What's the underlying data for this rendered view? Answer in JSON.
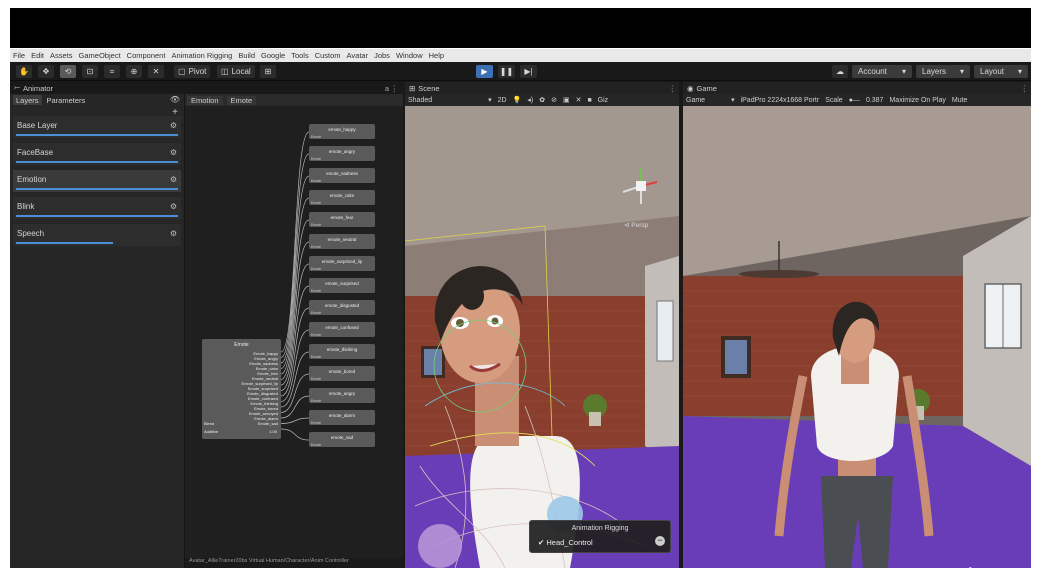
{
  "menu": [
    "File",
    "Edit",
    "Assets",
    "GameObject",
    "Component",
    "Animation Rigging",
    "Build",
    "Google",
    "Tools",
    "Custom",
    "Avatar",
    "Jobs",
    "Window",
    "Help"
  ],
  "toolbar": {
    "tools": [
      "hand-tool",
      "move-tool",
      "rotate-tool",
      "scale-tool",
      "rect-tool",
      "transform-tool",
      "custom-tool"
    ],
    "pivot_label": "Pivot",
    "local_label": "Local",
    "account_label": "Account",
    "layers_label": "Layers",
    "layout_label": "Layout"
  },
  "animator": {
    "title": "Animator",
    "tabs": [
      "Layers",
      "Parameters"
    ],
    "layers": [
      {
        "name": "Base Layer",
        "weight": 1.0
      },
      {
        "name": "FaceBase",
        "weight": 1.0
      },
      {
        "name": "Emotion",
        "weight": 1.0
      },
      {
        "name": "Blink",
        "weight": 1.0
      },
      {
        "name": "Speech",
        "weight": 0.6
      }
    ],
    "breadcrumb": [
      "Emotion",
      "Emote"
    ],
    "blend_tree_title": "Emote",
    "blend_params": [
      "Emote_happy",
      "Emote_angry",
      "Emote_sadness",
      "Emote_calm",
      "Emote_fear",
      "Emote_neutral",
      "Emote_surprised_lip",
      "Emote_surprised",
      "Emote_disgusted",
      "Emote_confused",
      "Emote_thinking",
      "Emote_bored",
      "Emote_annoyed",
      "Emote_alarm",
      "Emote_sad"
    ],
    "blend_footer_1": "Blend",
    "blend_footer_2": "Additive",
    "blend_value": "1.00",
    "states": [
      "emote_happy",
      "emote_angry",
      "emote_sadness",
      "emote_calm",
      "emote_fear",
      "emote_neutral",
      "emote_surprised_lip",
      "emote_surprised",
      "emote_disgusted",
      "emote_confused",
      "emote_thinking",
      "emote_bored",
      "emote_angry",
      "emote_alarm",
      "emote_sad"
    ],
    "state_tag": "Emote",
    "footer_path": "Avatar_AllieTrainer20bs Virtual Human/Character/Anim Controller"
  },
  "scene": {
    "title": "Scene",
    "shading": "Shaded",
    "mode_2d": "2D",
    "gizmos_label": "Giz",
    "persp_label": "Persp",
    "rig_popup_title": "Animation Rigging",
    "rig_popup_item": "Head_Control"
  },
  "game": {
    "title": "Game",
    "display": "Game",
    "resolution": "iPadPro 2224x1668 Portr",
    "scale_label": "Scale",
    "scale_value": "0.387",
    "maximize_label": "Maximize On Play",
    "mute_label": "Mute",
    "logo_text_1": "twenty",
    "logo_text_2": "bn"
  },
  "colors": {
    "play_button": "#3d6fb5",
    "layer_weight_bar": "#4a8fd6",
    "floor_purple": "#6a3db8",
    "brick_red": "#8a3e2e"
  }
}
